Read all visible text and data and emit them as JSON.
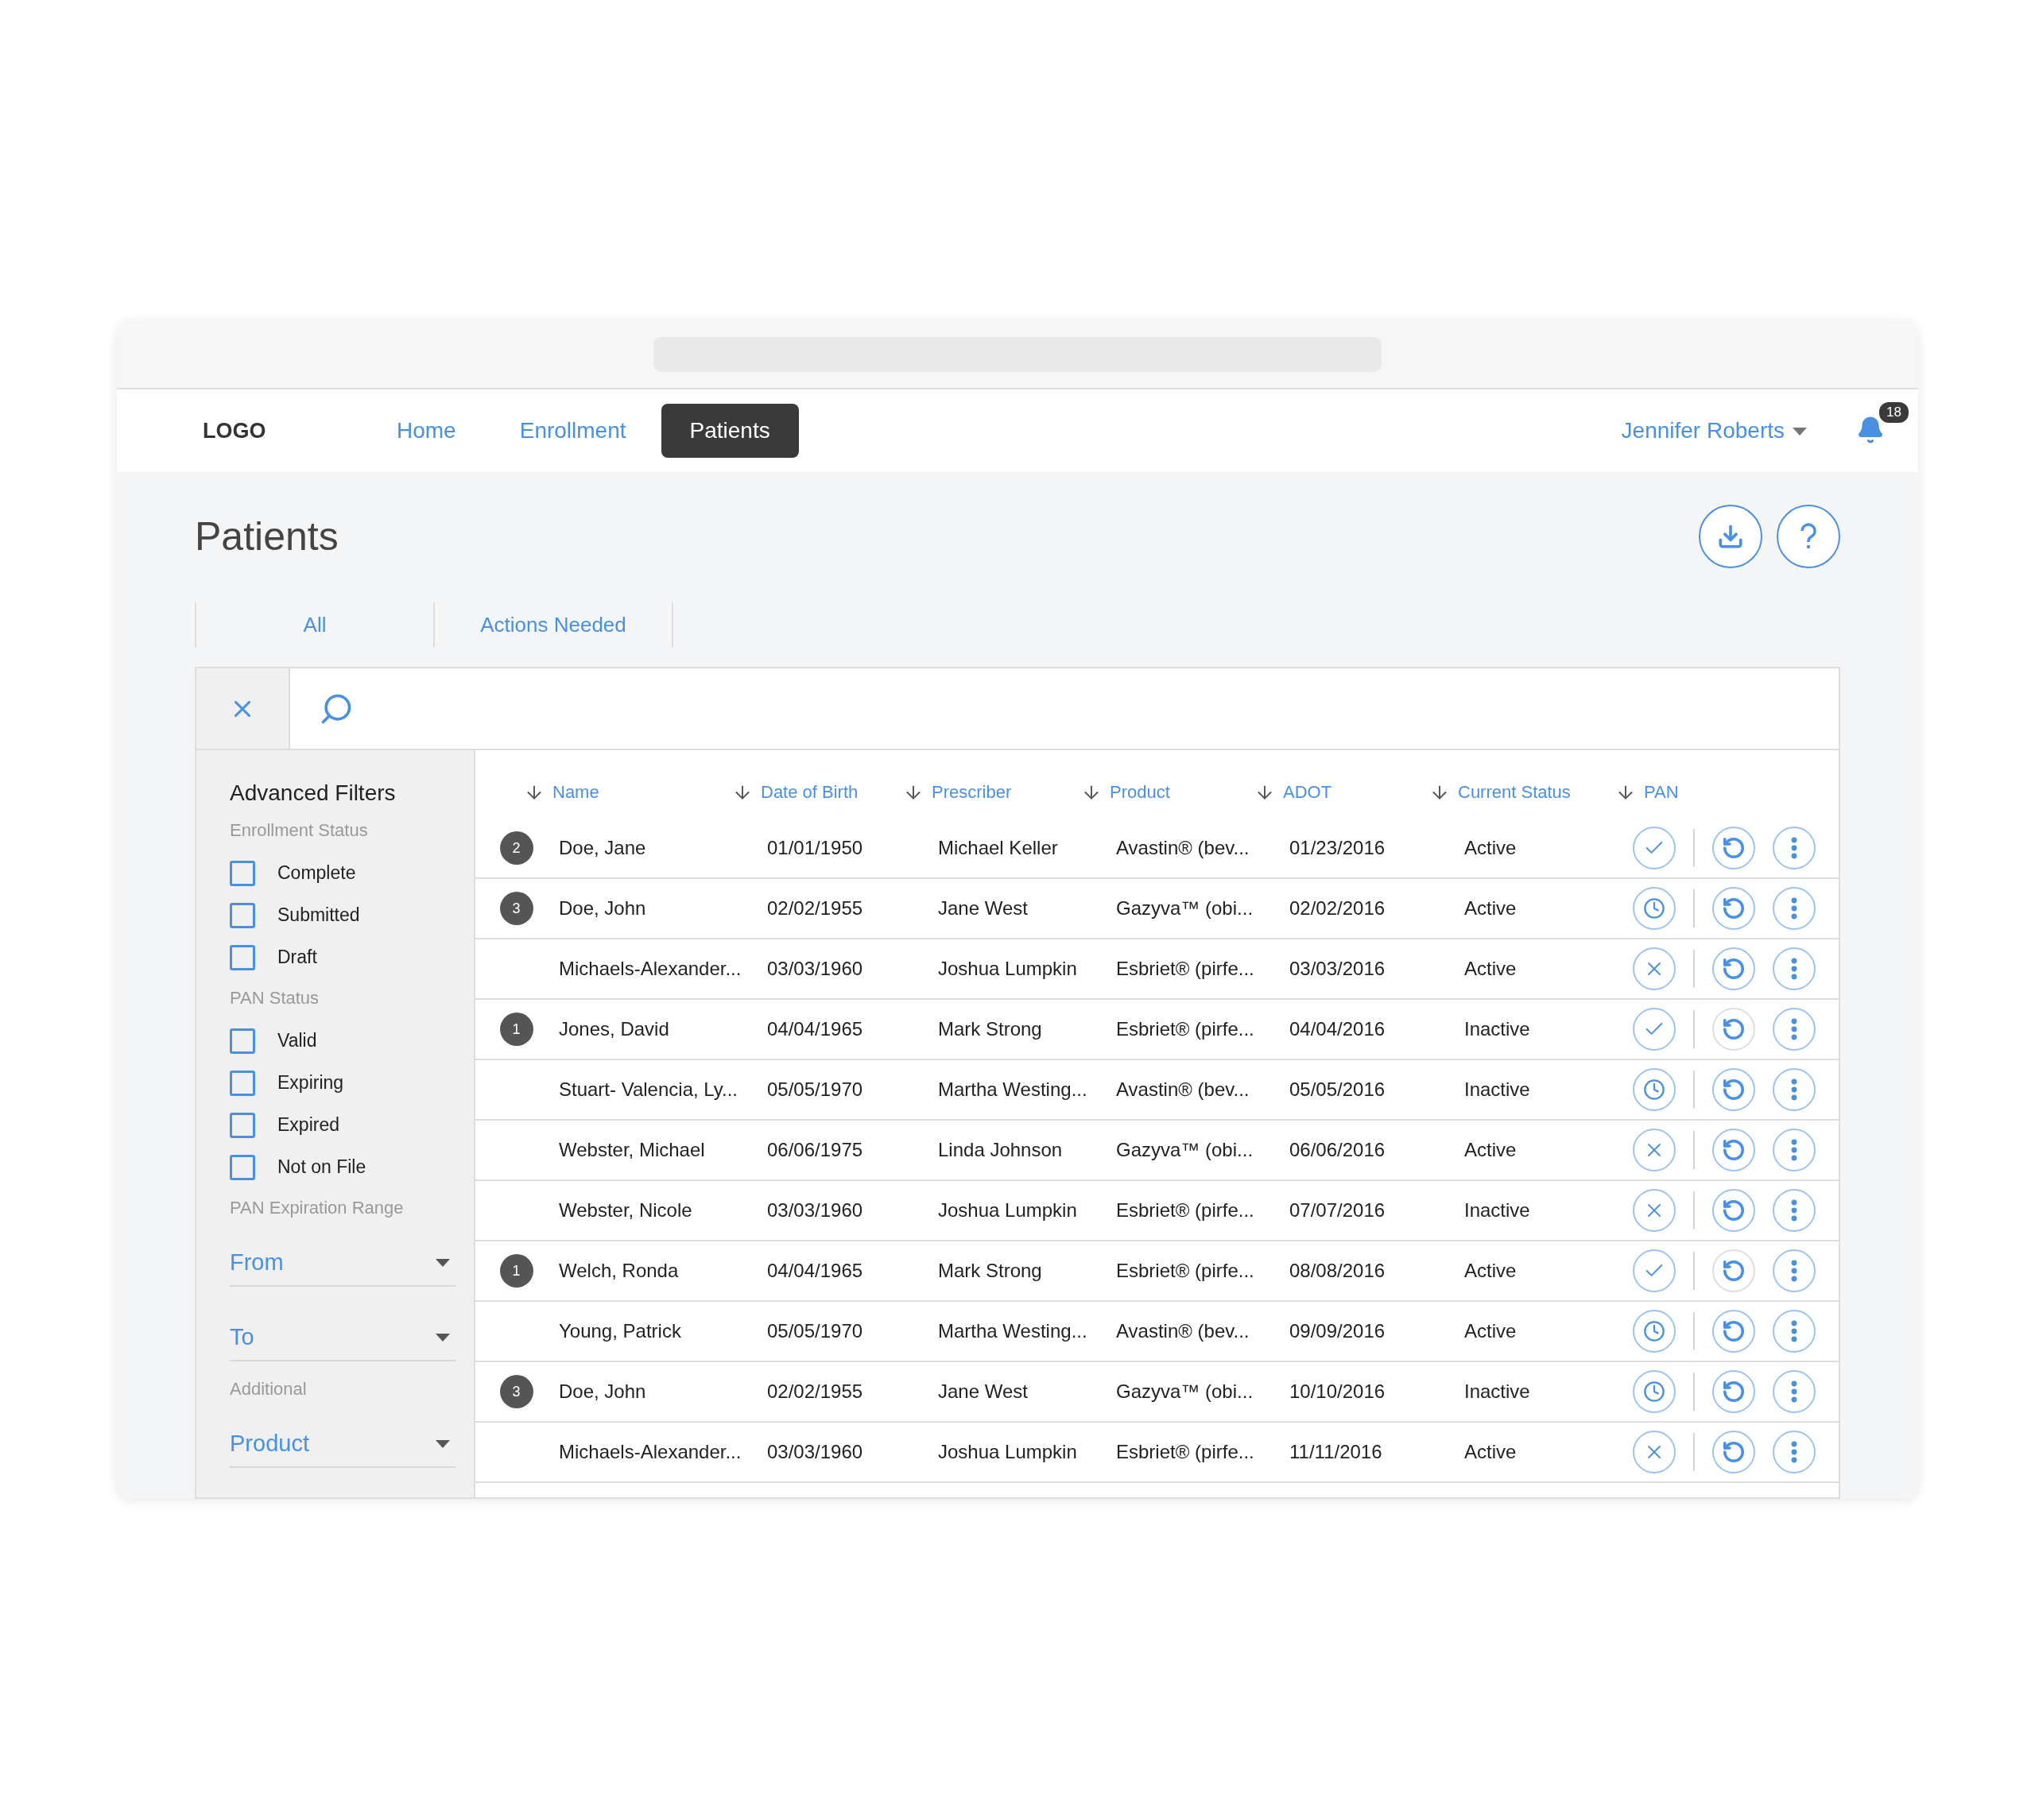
{
  "nav": {
    "logo": "LOGO",
    "links": [
      {
        "label": "Home",
        "selected": false
      },
      {
        "label": "Enrollment",
        "selected": false
      },
      {
        "label": "Patients",
        "selected": true
      }
    ],
    "user": "Jennifer Roberts",
    "notifications": "18"
  },
  "page": {
    "title": "Patients"
  },
  "tabs": [
    {
      "label": "All"
    },
    {
      "label": "Actions Needed"
    }
  ],
  "filters": {
    "title": "Advanced Filters",
    "sections": [
      {
        "heading": "Enrollment Status",
        "kind": "checkboxes",
        "items": [
          {
            "label": "Complete",
            "checked": false
          },
          {
            "label": "Submitted",
            "checked": false
          },
          {
            "label": "Draft",
            "checked": false
          }
        ]
      },
      {
        "heading": "PAN Status",
        "kind": "checkboxes",
        "items": [
          {
            "label": "Valid",
            "checked": false
          },
          {
            "label": "Expiring",
            "checked": false
          },
          {
            "label": "Expired",
            "checked": false
          },
          {
            "label": "Not on File",
            "checked": false
          }
        ]
      },
      {
        "heading": "PAN Expiration Range",
        "kind": "dropdowns",
        "items": [
          {
            "label": "From"
          },
          {
            "label": "To"
          }
        ]
      },
      {
        "heading": "Additional",
        "kind": "dropdowns",
        "items": [
          {
            "label": "Product"
          }
        ]
      }
    ]
  },
  "table": {
    "columns": [
      "Name",
      "Date of Birth",
      "Prescriber",
      "Product",
      "ADOT",
      "Current Status",
      "PAN"
    ],
    "rows": [
      {
        "badge": "2",
        "cells": [
          "Doe, Jane",
          "01/01/1950",
          "Michael Keller",
          "Avastin® (bev...",
          "01/23/2016",
          "Active"
        ],
        "pan": {
          "kind": "check"
        },
        "refresh_muted": false
      },
      {
        "badge": "3",
        "cells": [
          "Doe, John",
          "02/02/1955",
          "Jane West",
          "Gazyva™ (obi...",
          "02/02/2016",
          "Active"
        ],
        "pan": {
          "kind": "clock"
        },
        "refresh_muted": false
      },
      {
        "cells": [
          "Michaels-Alexander...",
          "03/03/1960",
          "Joshua Lumpkin",
          "Esbriet® (pirfe...",
          "03/03/2016",
          "Active"
        ],
        "pan": {
          "kind": "cross"
        },
        "refresh_muted": false
      },
      {
        "badge": "1",
        "cells": [
          "Jones, David",
          "04/04/1965",
          "Mark Strong",
          "Esbriet® (pirfe...",
          "04/04/2016",
          "Inactive"
        ],
        "pan": {
          "kind": "check"
        },
        "refresh_muted": true
      },
      {
        "cells": [
          "Stuart- Valencia, Ly...",
          "05/05/1970",
          "Martha Westing...",
          "Avastin® (bev...",
          "05/05/2016",
          "Inactive"
        ],
        "pan": {
          "kind": "clock"
        },
        "refresh_muted": false
      },
      {
        "cells": [
          "Webster, Michael",
          "06/06/1975",
          "Linda Johnson",
          "Gazyva™ (obi...",
          "06/06/2016",
          "Active"
        ],
        "pan": {
          "kind": "cross"
        },
        "refresh_muted": false
      },
      {
        "cells": [
          "Webster, Nicole",
          "03/03/1960",
          "Joshua Lumpkin",
          "Esbriet® (pirfe...",
          "07/07/2016",
          "Inactive"
        ],
        "pan": {
          "kind": "cross"
        },
        "refresh_muted": false
      },
      {
        "badge": "1",
        "cells": [
          "Welch, Ronda",
          "04/04/1965",
          "Mark Strong",
          "Esbriet® (pirfe...",
          "08/08/2016",
          "Active"
        ],
        "pan": {
          "kind": "check"
        },
        "refresh_muted": true
      },
      {
        "cells": [
          "Young, Patrick",
          "05/05/1970",
          "Martha Westing...",
          "Avastin® (bev...",
          "09/09/2016",
          "Active"
        ],
        "pan": {
          "kind": "clock"
        },
        "refresh_muted": false
      },
      {
        "badge": "3",
        "cells": [
          "Doe, John",
          "02/02/1955",
          "Jane West",
          "Gazyva™ (obi...",
          "10/10/2016",
          "Inactive"
        ],
        "pan": {
          "kind": "clock"
        },
        "refresh_muted": false
      },
      {
        "cells": [
          "Michaels-Alexander...",
          "03/03/1960",
          "Joshua Lumpkin",
          "Esbriet® (pirfe...",
          "11/11/2016",
          "Active"
        ],
        "pan": {
          "kind": "cross"
        },
        "refresh_muted": false
      }
    ]
  }
}
